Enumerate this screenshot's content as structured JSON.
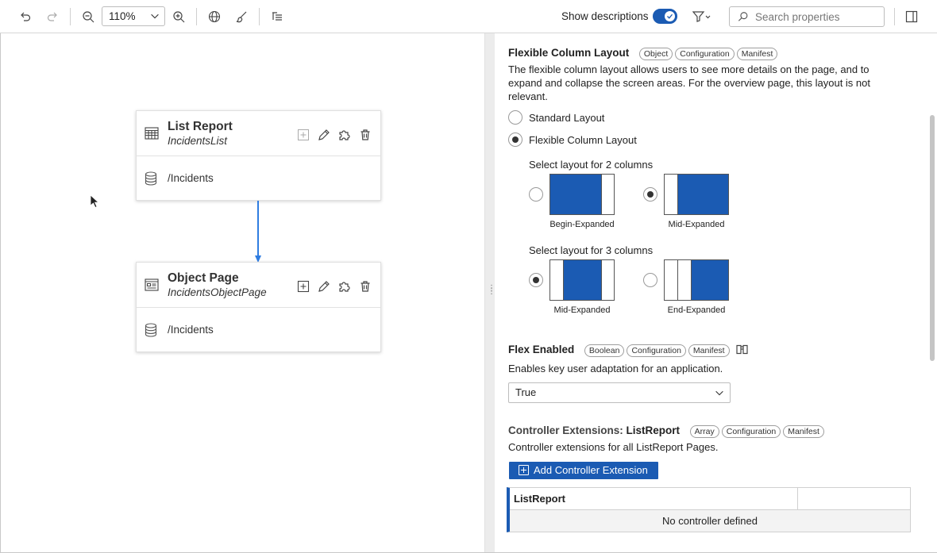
{
  "toolbar": {
    "zoom_value": "110%",
    "show_descriptions_label": "Show descriptions",
    "show_descriptions_on": true,
    "search_placeholder": "Search properties"
  },
  "canvas": {
    "nodes": [
      {
        "title": "List Report",
        "subtitle": "IncidentsList",
        "entity": "/Incidents"
      },
      {
        "title": "Object Page",
        "subtitle": "IncidentsObjectPage",
        "entity": "/Incidents"
      }
    ]
  },
  "panel": {
    "fcl": {
      "title": "Flexible Column Layout",
      "tags": [
        "Object",
        "Configuration",
        "Manifest"
      ],
      "description": "The flexible column layout allows users to see more details on the page, and to expand and collapse the screen areas. For the overview page, this layout is not relevant.",
      "options": [
        "Standard Layout",
        "Flexible Column Layout"
      ],
      "selected_option": "Flexible Column Layout",
      "two_col_label": "Select layout for 2 columns",
      "two_col_options": [
        "Begin-Expanded",
        "Mid-Expanded"
      ],
      "two_col_selected": "Mid-Expanded",
      "three_col_label": "Select layout for 3 columns",
      "three_col_options": [
        "Mid-Expanded",
        "End-Expanded"
      ],
      "three_col_selected": "Mid-Expanded"
    },
    "flex": {
      "title": "Flex Enabled",
      "tags": [
        "Boolean",
        "Configuration",
        "Manifest"
      ],
      "description": "Enables key user adaptation for an application.",
      "value": "True"
    },
    "controller": {
      "title_prefix": "Controller Extensions: ",
      "title_bold": "ListReport",
      "tags": [
        "Array",
        "Configuration",
        "Manifest"
      ],
      "description": "Controller extensions for all ListReport Pages.",
      "add_button": "Add Controller Extension",
      "table_header": "ListReport",
      "empty_text": "No controller defined"
    }
  },
  "colors": {
    "accent": "#1b5bb3",
    "connector": "#2f7de1"
  }
}
